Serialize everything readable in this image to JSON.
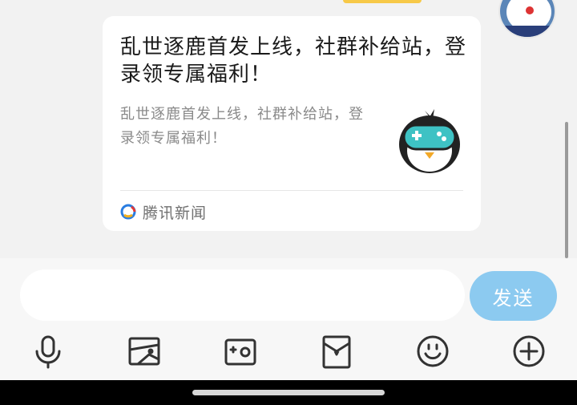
{
  "card": {
    "title": "乱世逐鹿首发上线，社群补给站，登录领专属福利！",
    "description": "乱世逐鹿首发上线，社群补给站，登录领专属福利！",
    "source": "腾讯新闻"
  },
  "composer": {
    "input_value": "",
    "input_placeholder": "",
    "send_label": "发送"
  },
  "toolbar": {
    "icons": [
      "microphone-icon",
      "image-icon",
      "camera-icon",
      "red-packet-icon",
      "emoji-icon",
      "plus-icon"
    ]
  },
  "colors": {
    "send_button": "#8ccaf0",
    "card_background": "#ffffff",
    "chat_background": "#f2f2f2",
    "nav_bar": "#000000"
  }
}
